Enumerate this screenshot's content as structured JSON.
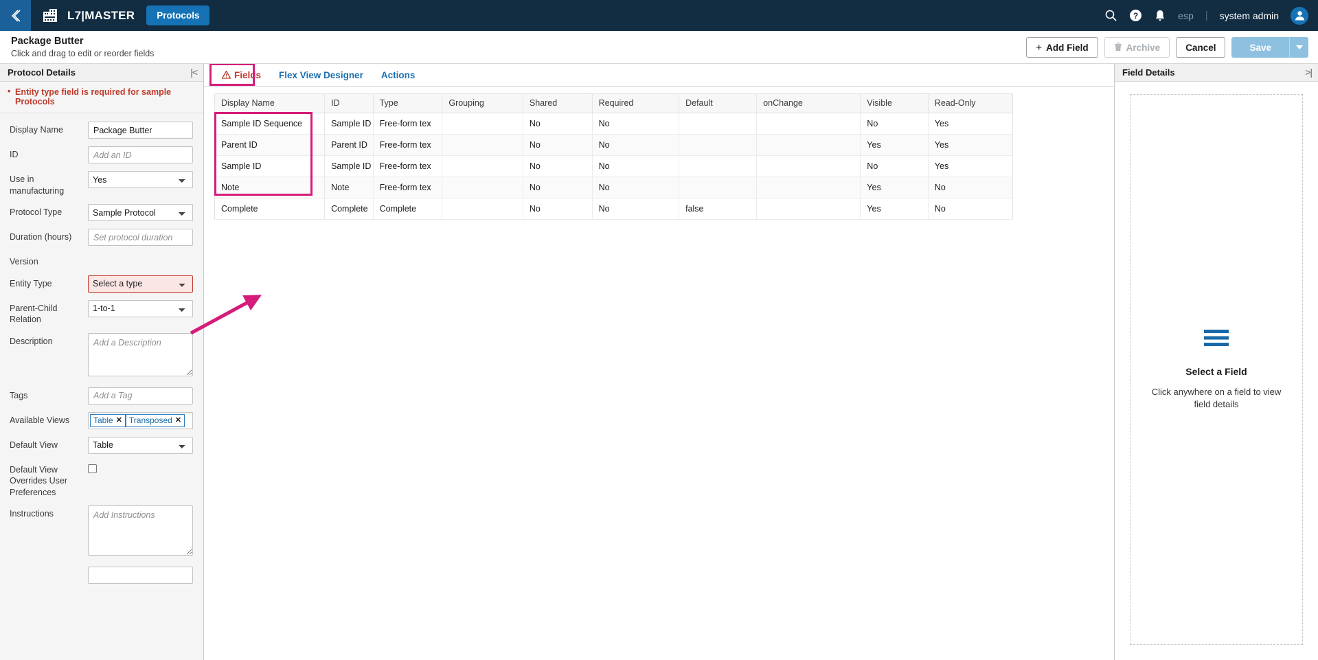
{
  "topnav": {
    "back_icon": "chevron-left-icon",
    "logo_icon": "l7-building-icon",
    "brand_title": "L7|MASTER",
    "protocols_label": "Protocols",
    "search_icon": "search-icon",
    "help_icon": "help-circle-icon",
    "notifications_icon": "bell-icon",
    "tenant": "esp",
    "separator": "|",
    "user_name": "system admin",
    "avatar_icon": "user-avatar-icon"
  },
  "pageheader": {
    "title": "Package Butter",
    "subtitle": "Click and drag to edit or reorder fields",
    "add_field_label": "Add Field",
    "add_field_icon": "plus-icon",
    "archive_label": "Archive",
    "archive_icon": "trash-icon",
    "cancel_label": "Cancel",
    "save_label": "Save",
    "save_caret_icon": "chevron-down-icon"
  },
  "left_panel": {
    "title": "Protocol Details",
    "collapse_icon": "collapse-left-icon",
    "error_message": "Entity type field is required for sample Protocols",
    "fields": [
      {
        "label": "Display Name",
        "value": "Package Butter",
        "placeholder": "",
        "control": "input"
      },
      {
        "label": "ID",
        "value": "",
        "placeholder": "Add an ID",
        "control": "input"
      },
      {
        "label": "Use in manufacturing",
        "value": "Yes",
        "control": "select"
      },
      {
        "label": "Protocol Type",
        "value": "Sample Protocol",
        "control": "select"
      },
      {
        "label": "Duration (hours)",
        "value": "",
        "placeholder": "Set protocol duration",
        "control": "input"
      },
      {
        "label": "Version",
        "value": "",
        "control": "none"
      },
      {
        "label": "Entity Type",
        "value": "Select a type",
        "control": "select-invalid"
      },
      {
        "label": "Parent-Child Relation",
        "value": "1-to-1",
        "control": "select"
      },
      {
        "label": "Description",
        "value": "",
        "placeholder": "Add a Description",
        "control": "textarea"
      },
      {
        "label": "Tags",
        "value": "",
        "placeholder": "Add a Tag",
        "control": "input"
      },
      {
        "label": "Available Views",
        "value": "",
        "control": "chips"
      },
      {
        "label": "Default View",
        "value": "Table",
        "control": "select"
      },
      {
        "label": "Default View Overrides User Preferences",
        "value": "",
        "control": "checkbox"
      },
      {
        "label": "Instructions",
        "value": "",
        "placeholder": "Add Instructions",
        "control": "textarea"
      }
    ],
    "available_views_chips": [
      "Table",
      "Transposed"
    ],
    "chip_remove_icon": "close-icon"
  },
  "tabs": [
    {
      "label": "Fields",
      "active": true,
      "icon": "warning-triangle-icon"
    },
    {
      "label": "Flex View Designer",
      "active": false,
      "icon": ""
    },
    {
      "label": "Actions",
      "active": false,
      "icon": ""
    }
  ],
  "fields_table": {
    "columns": [
      "Display Name",
      "ID",
      "Type",
      "Grouping",
      "Shared",
      "Required",
      "Default",
      "onChange",
      "Visible",
      "Read-Only"
    ],
    "rows": [
      {
        "dimmed": false,
        "cells": [
          "Sample ID Sequence",
          "Sample ID",
          "Free-form tex",
          "",
          "No",
          "No",
          "",
          "",
          "No",
          "Yes"
        ]
      },
      {
        "dimmed": true,
        "cells": [
          "Parent ID",
          "Parent ID",
          "Free-form tex",
          "",
          "No",
          "No",
          "",
          "",
          "Yes",
          "Yes"
        ]
      },
      {
        "dimmed": true,
        "cells": [
          "Sample ID",
          "Sample ID",
          "Free-form tex",
          "",
          "No",
          "No",
          "",
          "",
          "No",
          "Yes"
        ]
      },
      {
        "dimmed": true,
        "cells": [
          "Note",
          "Note",
          "Free-form tex",
          "",
          "No",
          "No",
          "",
          "",
          "Yes",
          "No"
        ]
      },
      {
        "dimmed": false,
        "cells": [
          "Complete",
          "Complete",
          "Complete",
          "",
          "No",
          "No",
          "false",
          "",
          "Yes",
          "No"
        ]
      }
    ]
  },
  "right_panel": {
    "title": "Field Details",
    "collapse_icon": "collapse-right-icon",
    "empty_icon": "list-lines-icon",
    "empty_title": "Select a Field",
    "empty_subtitle": "Click anywhere on a field to view field details"
  },
  "annotations": {
    "highlight_color": "#d51c7a",
    "arrow_name": "pink-arrow-annotation",
    "fields_tab_box_name": "fields-tab-highlight-box",
    "first_column_box_name": "display-name-column-highlight-box"
  },
  "colors": {
    "navbar": "#122c42",
    "accent_blue": "#1573b5",
    "error_red": "#c0392b",
    "annotation_pink": "#d51c7a",
    "save_disabled": "#8ec0e0"
  }
}
